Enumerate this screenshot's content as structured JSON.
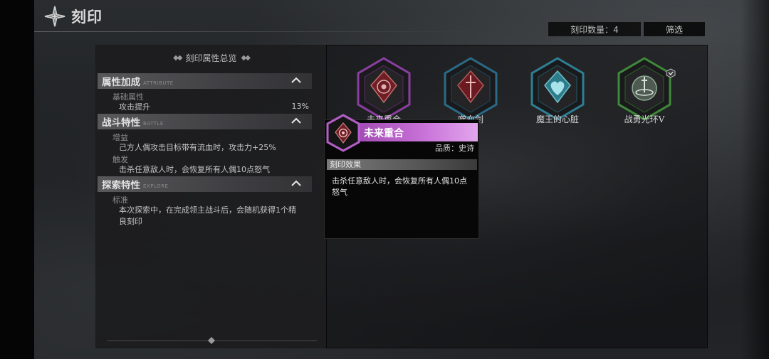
{
  "header": {
    "title": "刻印",
    "count_text": "刻印数量：4",
    "filter_label": "筛选"
  },
  "overview": {
    "title": "刻印属性总览",
    "sections": [
      {
        "name": "属性加成",
        "sub": "ATTRIBUTE",
        "groups": [
          {
            "head": "基础属性",
            "lines": [
              {
                "text": "攻击提升",
                "value": "13%"
              }
            ]
          }
        ]
      },
      {
        "name": "战斗特性",
        "sub": "BATTLE",
        "groups": [
          {
            "head": "增益",
            "lines": [
              {
                "text": "己方人偶攻击目标带有流血时，攻击力+25%"
              }
            ]
          },
          {
            "head": "触发",
            "lines": [
              {
                "text": "击杀任意敌人时，会恢复所有人偶10点怒气"
              }
            ]
          }
        ]
      },
      {
        "name": "探索特性",
        "sub": "EXPLORE",
        "groups": [
          {
            "head": "标准",
            "lines": [
              {
                "text": "本次探索中，在完成领主战斗后，会随机获得1个精"
              },
              {
                "text": "良刻印"
              }
            ]
          }
        ]
      }
    ]
  },
  "imprints": [
    {
      "name": "未来重合",
      "icon": "crimson-gear-icon",
      "color": "#8a3fa0"
    },
    {
      "name": "噬血剑",
      "icon": "blood-sword-icon",
      "color": "#2a6a86"
    },
    {
      "name": "魔王的心脏",
      "icon": "demon-heart-icon",
      "color": "#2e7f95"
    },
    {
      "name": "战勇光环V",
      "icon": "sword-aura-icon",
      "color": "#3f8a3a"
    }
  ],
  "tooltip": {
    "name": "未来重合",
    "quality": "品质：史诗",
    "effect_label": "刻印效果",
    "effect_text": "击杀任意敌人时，会恢复所有人偶10点怒气",
    "accent": "#c872d8"
  }
}
